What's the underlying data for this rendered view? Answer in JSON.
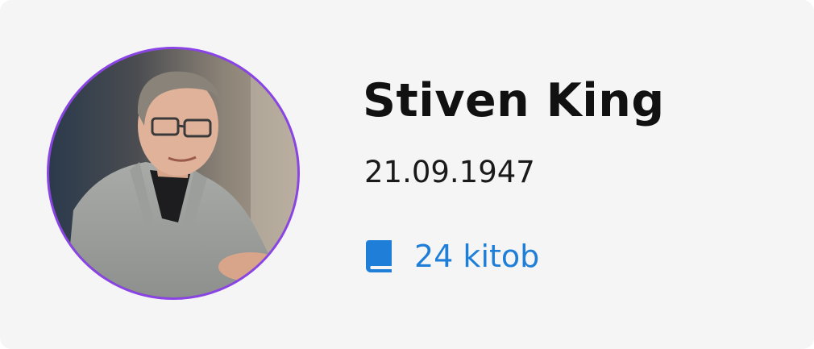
{
  "author": {
    "name": "Stiven King",
    "birth_date": "21.09.1947",
    "books_count_label": "24 kitob"
  },
  "icons": {
    "book": "book-icon"
  },
  "colors": {
    "card_background": "#f5f5f6",
    "avatar_ring": "#8a44e6",
    "accent": "#1f7fd8",
    "text_primary": "#111111"
  }
}
